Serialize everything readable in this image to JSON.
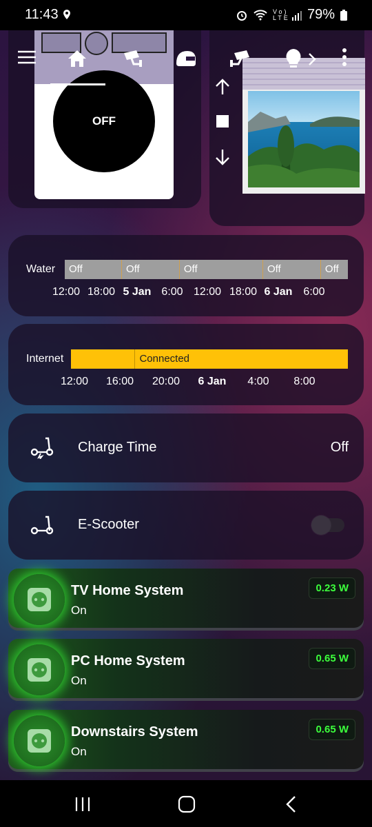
{
  "status": {
    "time": "11:43",
    "battery": "79%",
    "icons": [
      "location-icon",
      "alarm-icon",
      "wifi-icon",
      "volte-icon",
      "signal-icon",
      "battery-icon"
    ],
    "volte_label": "Vo) LTE"
  },
  "nav": {
    "items": [
      "home-icon",
      "security-camera-icon",
      "helmet-icon",
      "camera-icon",
      "lightbulb-icon"
    ],
    "active": "home-icon"
  },
  "washer": {
    "state": "OFF"
  },
  "blind": {
    "controls": [
      "arrow-up-icon",
      "stop-icon",
      "arrow-down-icon"
    ]
  },
  "water": {
    "label": "Water",
    "segments": [
      {
        "text": "Off",
        "width_pct": 20.5
      },
      {
        "text": "Off",
        "width_pct": 21.0
      },
      {
        "text": "Off",
        "width_pct": 30.3
      },
      {
        "text": "Off",
        "width_pct": 21.0
      },
      {
        "text": "Off",
        "width_pct": 10.0
      }
    ],
    "ticks": [
      {
        "text": "12:00",
        "bold": false
      },
      {
        "text": "18:00",
        "bold": false
      },
      {
        "text": "5 Jan",
        "bold": true
      },
      {
        "text": "6:00",
        "bold": false
      },
      {
        "text": "12:00",
        "bold": false
      },
      {
        "text": "18:00",
        "bold": false
      },
      {
        "text": "6 Jan",
        "bold": true
      },
      {
        "text": "6:00",
        "bold": false
      }
    ],
    "color": "#9e9e9e"
  },
  "internet": {
    "label": "Internet",
    "segment_text": "Connected",
    "ticks": [
      {
        "text": "12:00",
        "bold": false
      },
      {
        "text": "16:00",
        "bold": false
      },
      {
        "text": "20:00",
        "bold": false
      },
      {
        "text": "6 Jan",
        "bold": true
      },
      {
        "text": "4:00",
        "bold": false
      },
      {
        "text": "8:00",
        "bold": false
      }
    ],
    "color": "#ffc107"
  },
  "charge_time": {
    "label": "Charge Time",
    "value": "Off"
  },
  "escooter": {
    "label": "E-Scooter",
    "on": false
  },
  "plugs": [
    {
      "title": "TV Home System",
      "state": "On",
      "power": "0.23 W"
    },
    {
      "title": "PC Home System",
      "state": "On",
      "power": "0.65 W"
    },
    {
      "title": "Downstairs System",
      "state": "On",
      "power": "0.65 W"
    }
  ],
  "sysnav": [
    "recents-button",
    "home-button",
    "back-button"
  ]
}
